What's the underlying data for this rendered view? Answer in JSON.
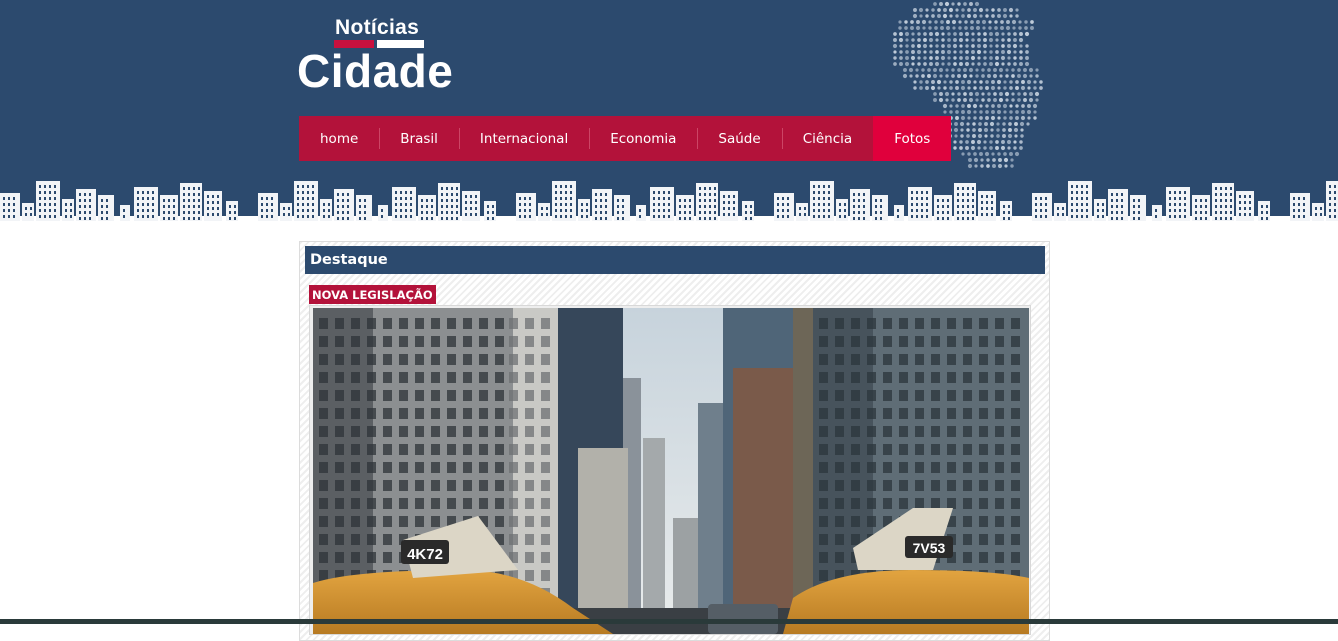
{
  "logo": {
    "small": "Notícias",
    "big": "Cidade"
  },
  "nav": {
    "items": [
      {
        "label": "home"
      },
      {
        "label": "Brasil"
      },
      {
        "label": "Internacional"
      },
      {
        "label": "Economia"
      },
      {
        "label": "Saúde"
      },
      {
        "label": "Ciência"
      },
      {
        "label": "Fotos"
      }
    ],
    "active": "Fotos"
  },
  "main": {
    "section_title": "Destaque",
    "badge": "NOVA LEGISLAÇÃO",
    "photo": {
      "taxi_left": "4K72",
      "taxi_right": "7V53"
    }
  },
  "colors": {
    "header": "#2c4a6e",
    "accent": "#b3123a",
    "active": "#e0003c"
  },
  "icons": [
    "brazil-map-icon",
    "city-skyline-decoration"
  ]
}
